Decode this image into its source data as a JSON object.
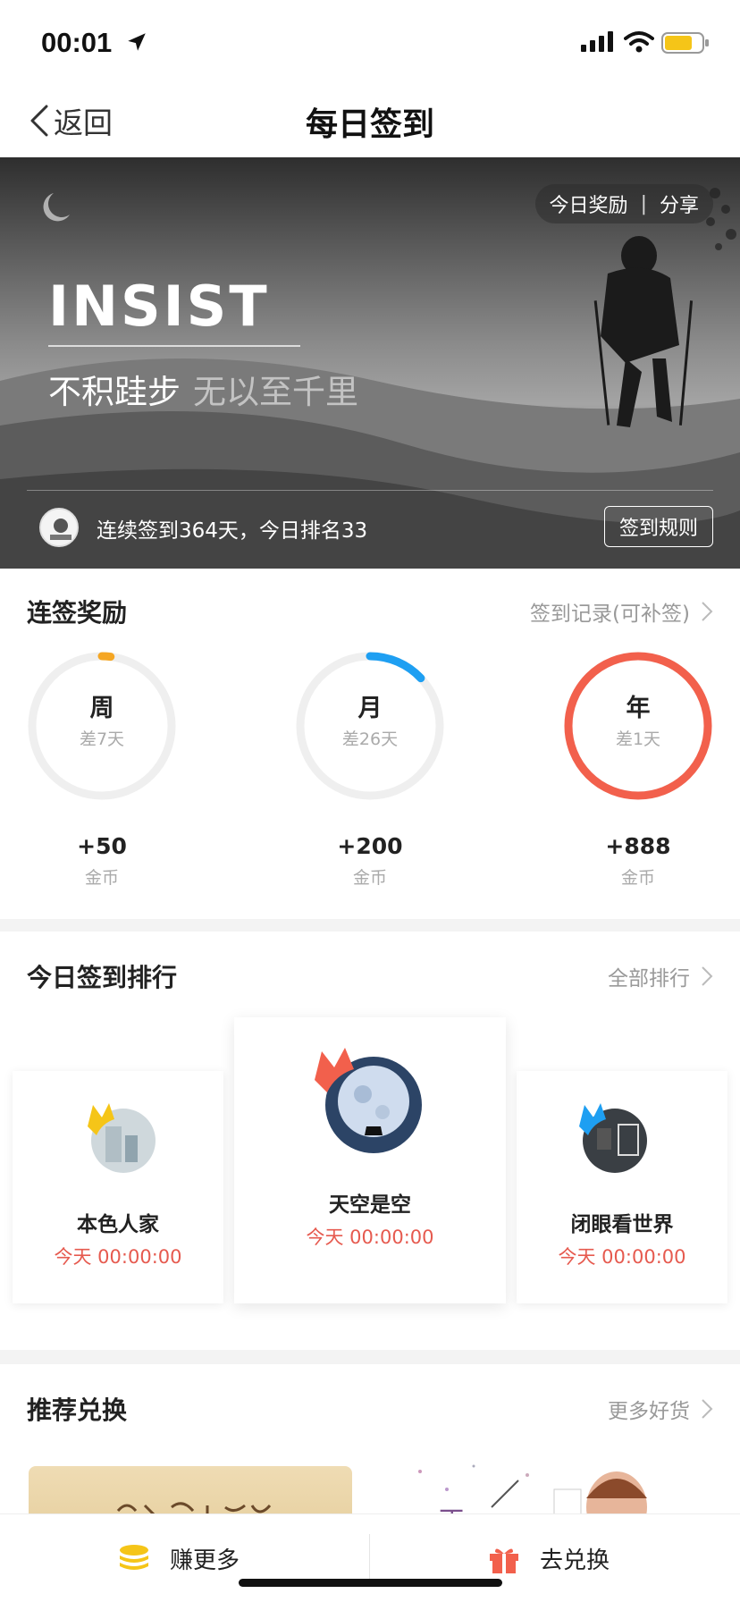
{
  "status": {
    "time": "00:01",
    "icons": [
      "location-arrow-icon",
      "cellular-signal-icon",
      "wifi-icon",
      "battery-icon"
    ],
    "battery_color": "#f5c518"
  },
  "nav": {
    "back_label": "返回",
    "title": "每日签到"
  },
  "banner": {
    "today_reward": "今日奖励",
    "divider": "|",
    "share": "分享",
    "headline": "INSIST",
    "slogan_main": "不积跬步",
    "slogan_dim": "无以至千里",
    "streak_text": "连续签到364天，今日排名33",
    "rules_button": "签到规则"
  },
  "streak_rewards": {
    "title": "连签奖励",
    "link": "签到记录(可补签)",
    "items": [
      {
        "label": "周",
        "remaining": "差7天",
        "reward": "+50",
        "unit": "金币",
        "progress": 0.02,
        "color": "#f5a623"
      },
      {
        "label": "月",
        "remaining": "差26天",
        "reward": "+200",
        "unit": "金币",
        "progress": 0.13,
        "color": "#1e9ff2"
      },
      {
        "label": "年",
        "remaining": "差1天",
        "reward": "+888",
        "unit": "金币",
        "progress": 1.0,
        "color": "#f2604c"
      }
    ]
  },
  "ranking": {
    "title": "今日签到排行",
    "link": "全部排行",
    "entries": [
      {
        "name": "本色人家",
        "time": "今天 00:00:00",
        "crown_color": "#f5c518"
      },
      {
        "name": "天空是空",
        "time": "今天 00:00:00",
        "crown_color": "#f2604c"
      },
      {
        "name": "闭眼看世界",
        "time": "今天 00:00:00",
        "crown_color": "#1e9ff2"
      }
    ]
  },
  "recommend": {
    "title": "推荐兑换",
    "link": "更多好货"
  },
  "bottom_bar": {
    "earn_more": "赚更多",
    "redeem": "去兑换"
  }
}
